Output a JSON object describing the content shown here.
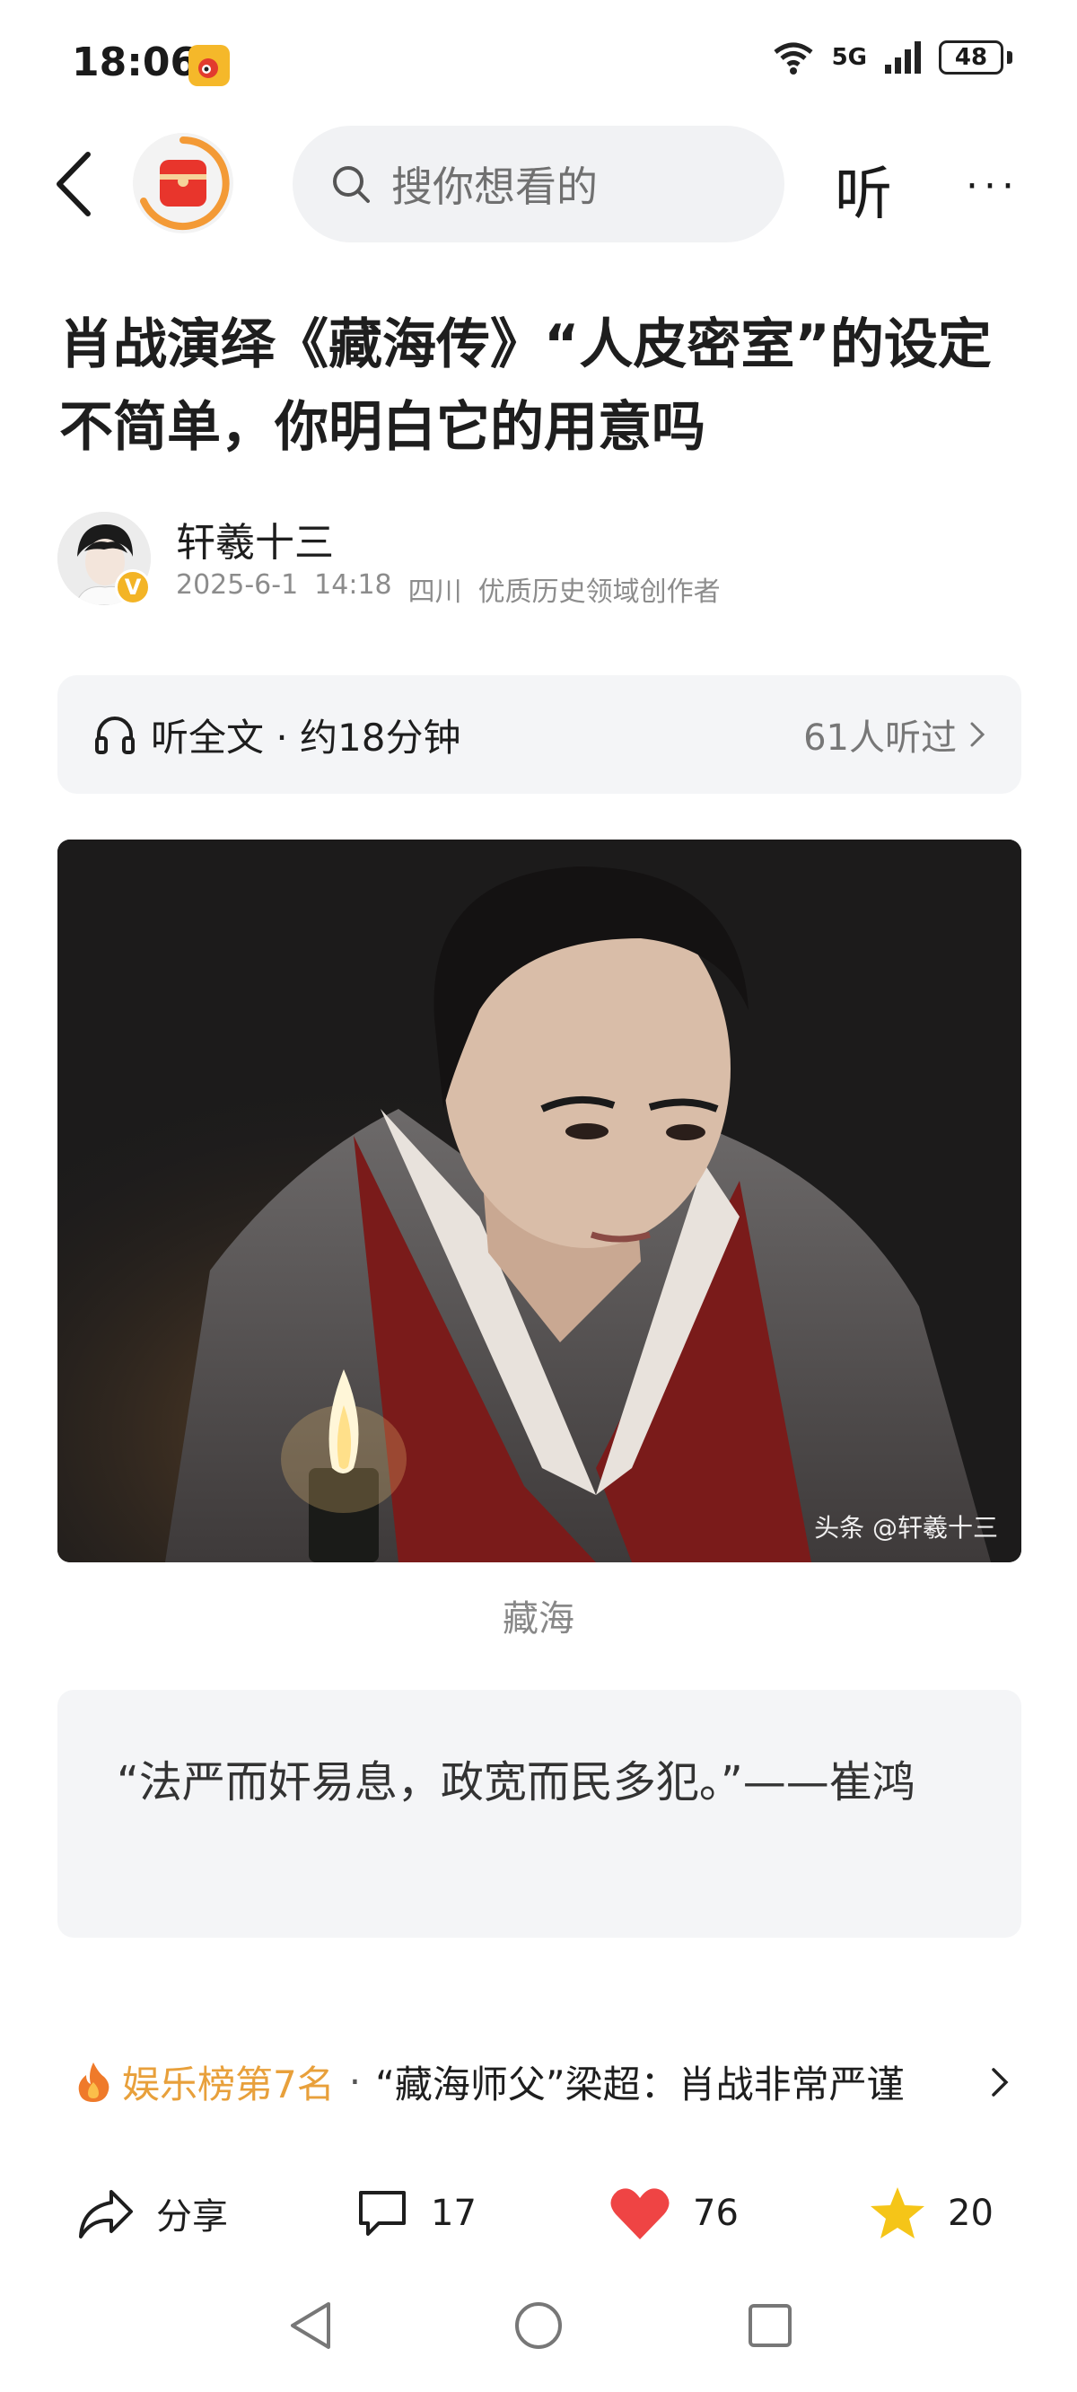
{
  "status_bar": {
    "time": "18:06",
    "network": "5G",
    "battery": "48"
  },
  "top_nav": {
    "search_placeholder": "搜你想看的",
    "listen_label": "听",
    "more_label": "···"
  },
  "article": {
    "title": "肖战演绎《藏海传》“人皮密室”的设定不简单，你明白它的用意吗",
    "author": {
      "name": "轩羲十三",
      "date": "2025-6-1",
      "time": "14:18",
      "location": "四川",
      "tag": "优质历史领域创作者",
      "badge": "V"
    },
    "audio": {
      "label": "听全文 · 约18分钟",
      "listeners": "61人听过"
    },
    "image": {
      "watermark": "头条 @轩羲十三",
      "caption": "藏海"
    },
    "quote": "“法严而奸易息，政宽而民多犯。”——崔鸿"
  },
  "ranking": {
    "label": "娱乐榜第7名",
    "separator": "·",
    "headline": "“藏海师父”梁超：肖战非常严谨"
  },
  "actions": {
    "share_label": "分享",
    "comments": "17",
    "likes": "76",
    "favorites": "20"
  },
  "colors": {
    "accent_orange": "#e8a03b",
    "like_red": "#ef4444",
    "star_yellow": "#f5c518",
    "verified_gold": "#f3b426"
  }
}
